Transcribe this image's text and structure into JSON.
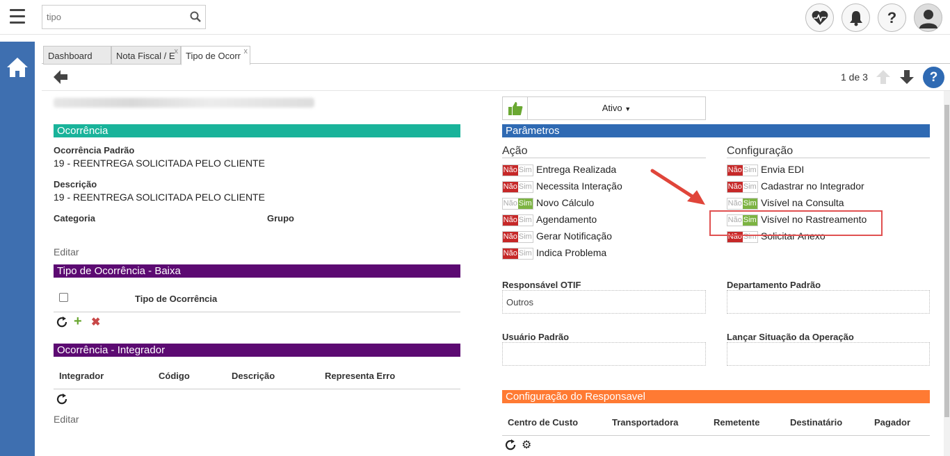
{
  "header": {
    "search_placeholder": "tipo"
  },
  "tabs": [
    {
      "label": "Dashboard"
    },
    {
      "label": "Nota Fiscal / E"
    },
    {
      "label": "Tipo de Ocorr"
    }
  ],
  "toolbar": {
    "pager": "1 de 3",
    "help": "?"
  },
  "status": {
    "label": "Ativo"
  },
  "ocorrencia": {
    "title": "Ocorrência",
    "padrao_label": "Ocorrência Padrão",
    "padrao_value": "19 - REENTREGA SOLICITADA PELO CLIENTE",
    "descricao_label": "Descrição",
    "descricao_value": "19 - REENTREGA SOLICITADA PELO CLIENTE",
    "categoria_label": "Categoria",
    "grupo_label": "Grupo",
    "editar": "Editar"
  },
  "baixa": {
    "title": "Tipo de Ocorrência - Baixa",
    "col": "Tipo de Ocorrência"
  },
  "integrador": {
    "title": "Ocorrência - Integrador",
    "cols": [
      "Integrador",
      "Código",
      "Descrição",
      "Representa Erro"
    ],
    "editar": "Editar"
  },
  "parametros": {
    "title": "Parâmetros",
    "acao_title": "Ação",
    "config_title": "Configuração",
    "toggle_no": "Não",
    "toggle_yes": "Sim",
    "acao": [
      {
        "label": "Entrega Realizada",
        "value": "Não"
      },
      {
        "label": "Necessita Interação",
        "value": "Não"
      },
      {
        "label": "Novo Cálculo",
        "value": "Sim"
      },
      {
        "label": "Agendamento",
        "value": "Não"
      },
      {
        "label": "Gerar Notificação",
        "value": "Não"
      },
      {
        "label": "Indica Problema",
        "value": "Não"
      }
    ],
    "config": [
      {
        "label": "Envia EDI",
        "value": "Não"
      },
      {
        "label": "Cadastrar no Integrador",
        "value": "Não"
      },
      {
        "label": "Visível na Consulta",
        "value": "Sim"
      },
      {
        "label": "Visível no Rastreamento",
        "value": "Sim"
      },
      {
        "label": "Solicitar Anexo",
        "value": "Não"
      }
    ],
    "resp_otif_label": "Responsável OTIF",
    "resp_otif_value": "Outros",
    "depto_label": "Departamento Padrão",
    "usuario_label": "Usuário Padrão",
    "lancar_label": "Lançar Situação da Operação"
  },
  "config_resp": {
    "title": "Configuração do Responsavel",
    "cols": [
      "Centro de Custo",
      "Transportadora",
      "Remetente",
      "Destinatário",
      "Pagador"
    ]
  },
  "colors": {
    "teal": "#19b39a",
    "purple": "#5c0a72",
    "blue": "#2f6ab3",
    "orange": "#ff7a33",
    "sidebar": "#3e6fb0"
  }
}
